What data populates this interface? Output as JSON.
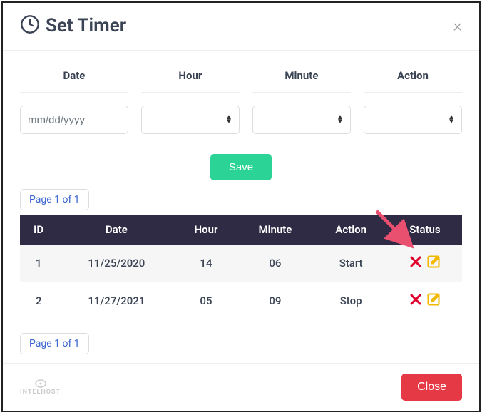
{
  "modal": {
    "title": "Set Timer",
    "close_x": "×"
  },
  "form": {
    "headers": {
      "date": "Date",
      "hour": "Hour",
      "minute": "Minute",
      "action": "Action"
    },
    "date_placeholder": "mm/dd/yyyy",
    "save_label": "Save"
  },
  "pagination": {
    "top": "Page 1 of 1",
    "bottom": "Page 1 of 1"
  },
  "table": {
    "headers": {
      "id": "ID",
      "date": "Date",
      "hour": "Hour",
      "minute": "Minute",
      "action": "Action",
      "status": "Status"
    },
    "rows": [
      {
        "id": "1",
        "date": "11/25/2020",
        "hour": "14",
        "minute": "06",
        "action": "Start"
      },
      {
        "id": "2",
        "date": "11/27/2021",
        "hour": "05",
        "minute": "09",
        "action": "Stop"
      }
    ]
  },
  "footer": {
    "brand": "INTELHOST",
    "close_label": "Close"
  },
  "colors": {
    "header_bg": "#2f2b44",
    "save": "#2bd396",
    "close": "#e63946",
    "delete": "#e1002b",
    "edit": "#f3b900"
  }
}
